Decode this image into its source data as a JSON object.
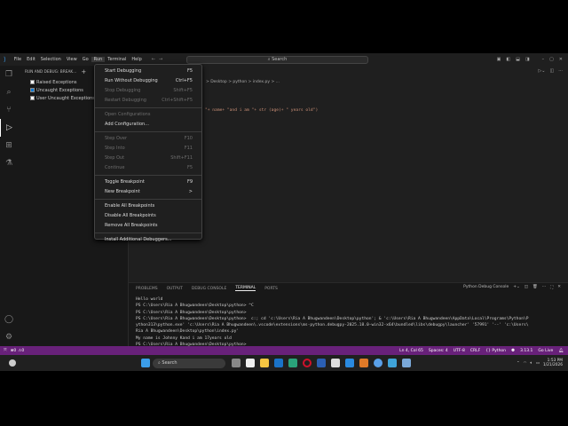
{
  "menubar": [
    "File",
    "Edit",
    "Selection",
    "View",
    "Go",
    "Run",
    "Terminal",
    "Help"
  ],
  "search_placeholder": "Search",
  "sidebar": {
    "title": "RUN AND DEBUG: BREAK...",
    "breakpoints": [
      {
        "label": "Raised Exceptions",
        "checked": false
      },
      {
        "label": "Uncaught Exceptions",
        "checked": true
      },
      {
        "label": "User Uncaught Exceptions",
        "checked": false
      }
    ]
  },
  "run_menu": [
    [
      {
        "label": "Start Debugging",
        "key": "F5",
        "enabled": true
      },
      {
        "label": "Run Without Debugging",
        "key": "Ctrl+F5",
        "enabled": true
      },
      {
        "label": "Stop Debugging",
        "key": "Shift+F5",
        "enabled": false
      },
      {
        "label": "Restart Debugging",
        "key": "Ctrl+Shift+F5",
        "enabled": false
      }
    ],
    [
      {
        "label": "Open Configurations",
        "key": "",
        "enabled": false
      },
      {
        "label": "Add Configuration...",
        "key": "",
        "enabled": true
      }
    ],
    [
      {
        "label": "Step Over",
        "key": "F10",
        "enabled": false
      },
      {
        "label": "Step Into",
        "key": "F11",
        "enabled": false
      },
      {
        "label": "Step Out",
        "key": "Shift+F11",
        "enabled": false
      },
      {
        "label": "Continue",
        "key": "F5",
        "enabled": false
      }
    ],
    [
      {
        "label": "Toggle Breakpoint",
        "key": "F9",
        "enabled": true
      },
      {
        "label": "New Breakpoint",
        "key": ">",
        "enabled": true
      }
    ],
    [
      {
        "label": "Enable All Breakpoints",
        "key": "",
        "enabled": true
      },
      {
        "label": "Disable All Breakpoints",
        "key": "",
        "enabled": true
      },
      {
        "label": "Remove All Breakpoints",
        "key": "",
        "enabled": true
      }
    ],
    [
      {
        "label": "Install Additional Debuggers...",
        "key": "",
        "enabled": true
      }
    ]
  ],
  "breadcrumb": "> Desktop > python > index.py > ...",
  "code_line": "\"+ name+ \"and i am \"+ str (age)+ \" years old\")",
  "panel": {
    "tabs": [
      "PROBLEMS",
      "OUTPUT",
      "DEBUG CONSOLE",
      "TERMINAL",
      "PORTS"
    ],
    "active": "TERMINAL",
    "terminal_name": "Python Debug Console",
    "lines": [
      "Hello world",
      "PS C:\\Users\\Ria A Bhugwandeen\\Desktop\\python> ^C",
      "PS C:\\Users\\Ria A Bhugwandeen\\Desktop\\python>",
      "PS C:\\Users\\Ria A Bhugwandeen\\Desktop\\python>  c:; cd 'c:\\Users\\Ria A Bhugwandeen\\Desktop\\python'; & 'c:\\Users\\Ria A Bhugwandeen\\AppData\\Local\\Programs\\Python\\P",
      "ython313\\python.exe' 'c:\\Users\\Ria A Bhugwandeen\\.vscode\\extensions\\ms-python.debugpy-2025.18.0-win32-x64\\bundled\\libs\\debugpy\\launcher' '57991' '--' 'c:\\Users\\",
      "Ria A Bhugwandeen\\Desktop\\python\\index.py'",
      "My name is Johnny Kand i am 17years old",
      "PS C:\\Users\\Ria A Bhugwandeen\\Desktop\\python> "
    ]
  },
  "status": {
    "errors": "0",
    "warnings": "0",
    "position": "Ln 4, Col 65",
    "spaces": "Spaces: 4",
    "encoding": "UTF-8",
    "eol": "CRLF",
    "language": "{} Python",
    "version": "3.13.1",
    "golive": "Go Live",
    "color": "#68217a"
  },
  "taskbar": {
    "search": "Search",
    "time": "1:53 PM",
    "date": "1/21/2026"
  }
}
